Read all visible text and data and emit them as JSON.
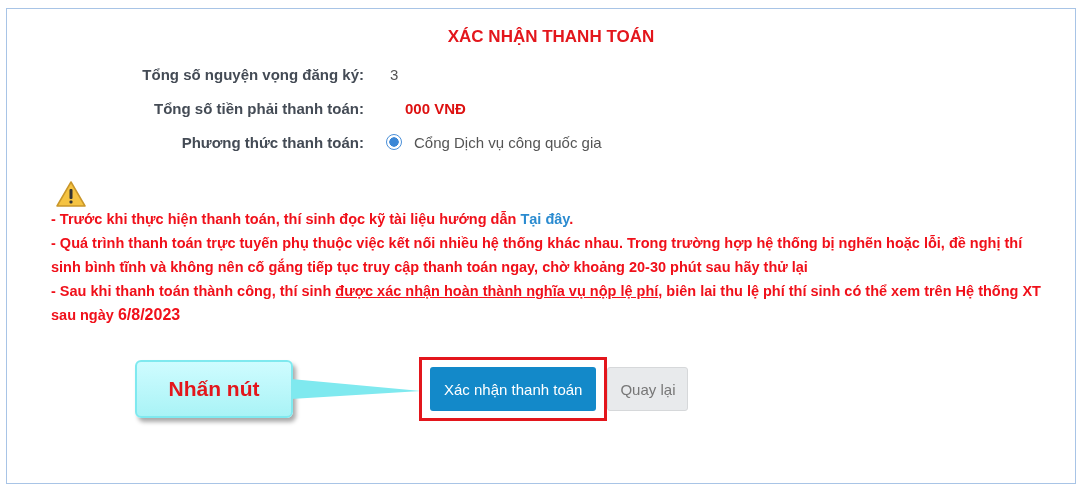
{
  "title": "XÁC NHẬN THANH TOÁN",
  "fields": [
    {
      "label": "Tổng số nguyện vọng đăng ký:",
      "value": "3",
      "kind": "plain"
    },
    {
      "label": "Tổng số tiền phải thanh toán:",
      "value": "000 VNĐ",
      "kind": "amount"
    },
    {
      "label": "Phương thức thanh toán:",
      "value": "Cổng Dịch vụ công quốc gia",
      "kind": "radio",
      "selected": true
    }
  ],
  "notes": [
    [
      {
        "kind": "text",
        "text": "- Trước khi thực hiện thanh toán, thí sinh đọc kỹ tài liệu hướng dẫn "
      },
      {
        "kind": "link",
        "text": "Tại đây"
      },
      {
        "kind": "text",
        "text": "."
      }
    ],
    [
      {
        "kind": "text",
        "text": "- Quá trình thanh toán trực tuyến phụ thuộc việc kết nối nhiều hệ thống khác nhau. Trong trường hợp hệ thống bị nghẽn hoặc lỗi, đề nghị thí sinh bình tĩnh và không nên cố gắng tiếp tục truy cập thanh toán ngay, chờ khoảng 20-30 phút sau hãy thử lại"
      }
    ],
    [
      {
        "kind": "text",
        "text": "- Sau khi thanh toán thành công, thí sinh "
      },
      {
        "kind": "underline",
        "text": "được xác nhận hoàn thành nghĩa vụ nộp lệ phí"
      },
      {
        "kind": "text",
        "text": ", biên lai thu lệ phí thí sinh có thể xem trên Hệ thống XT sau ngày "
      },
      {
        "kind": "strong",
        "text": "6/8/2023"
      }
    ]
  ],
  "callout": "Nhấn nút",
  "buttons": [
    {
      "label": "Xác nhận thanh toán",
      "kind": "primary",
      "highlighted": true
    },
    {
      "label": "Quay lại",
      "kind": "secondary",
      "highlighted": false
    }
  ]
}
